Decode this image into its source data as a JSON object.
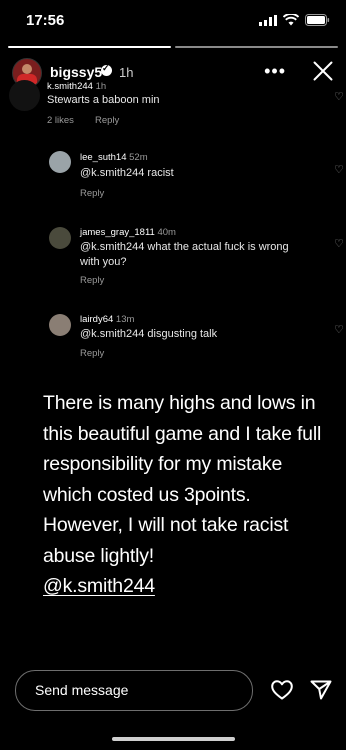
{
  "status_bar": {
    "time": "17:56"
  },
  "story": {
    "username": "bigssy5",
    "time": "1h"
  },
  "comments": [
    {
      "user": "k.smith244",
      "time": "1h",
      "text": "Stewarts a baboon min",
      "likes": "2 likes",
      "reply": "Reply"
    },
    {
      "user": "lee_suth14",
      "time": "52m",
      "text": "@k.smith244 racist",
      "reply": "Reply"
    },
    {
      "user": "james_gray_1811",
      "time": "40m",
      "text": "@k.smith244 what the actual fuck is wrong",
      "text2": "with you?",
      "reply": "Reply"
    },
    {
      "user": "lairdy64",
      "time": "13m",
      "text": "@k.smith244 disgusting talk",
      "reply": "Reply"
    }
  ],
  "caption": {
    "lines": [
      "There is many highs and lows in",
      "this beautiful game and I take full",
      "responsibility for my mistake",
      "which costed us 3points.",
      "However, I will not take racist",
      "abuse lightly!"
    ],
    "mention": "@k.smith244"
  },
  "reply_bar": {
    "placeholder": "Send message"
  }
}
